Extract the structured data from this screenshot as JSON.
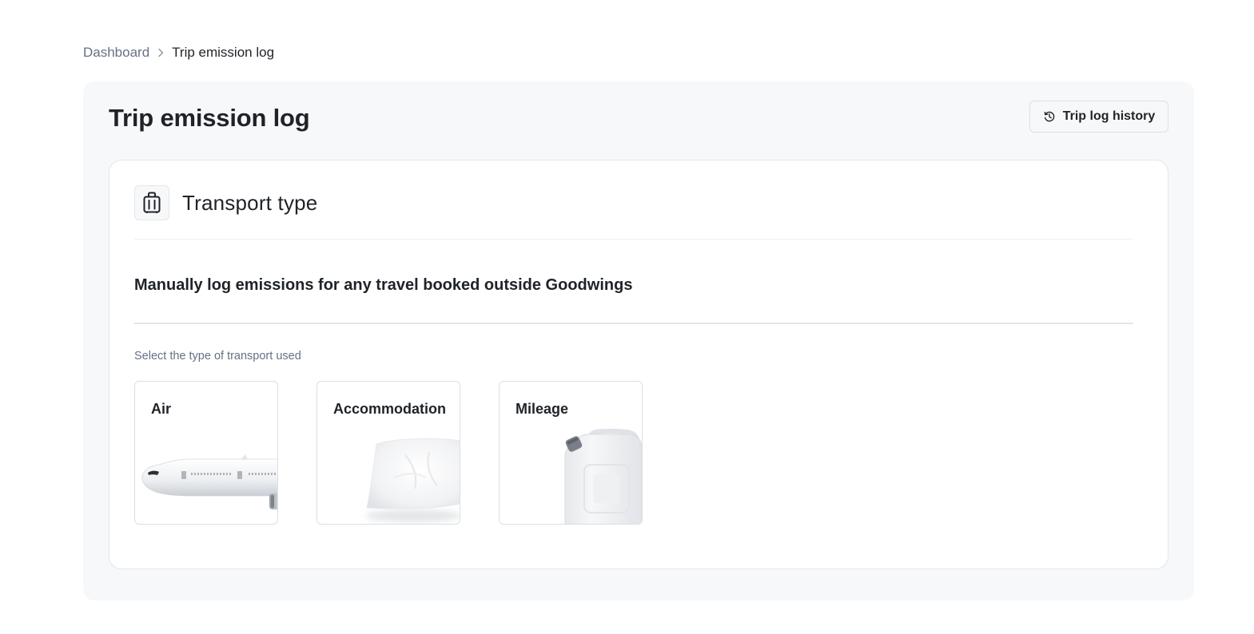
{
  "breadcrumb": {
    "parent": "Dashboard",
    "current": "Trip emission log"
  },
  "page": {
    "title": "Trip emission log",
    "history_button": "Trip log history"
  },
  "card": {
    "icon": "luggage-icon",
    "title": "Transport type",
    "subtitle": "Manually log emissions for any travel booked outside Goodwings",
    "select_label": "Select the type of transport used",
    "options": [
      {
        "label": "Air",
        "icon": "airplane-image"
      },
      {
        "label": "Accommodation",
        "icon": "pillow-image"
      },
      {
        "label": "Mileage",
        "icon": "fuel-canister-image"
      }
    ]
  },
  "colors": {
    "muted_text": "#667085",
    "panel_bg": "#f7f8fa",
    "border": "#dcdfe4"
  }
}
